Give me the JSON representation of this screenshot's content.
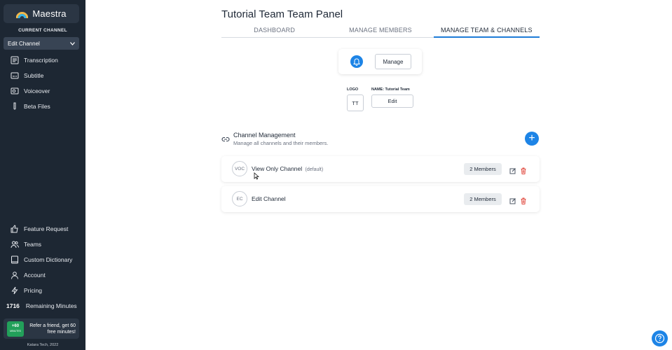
{
  "sidebar": {
    "brand_name": "Maestra",
    "current_channel_label": "CURRENT CHANNEL",
    "channel_select_value": "Edit Channel",
    "top_items": [
      {
        "label": "Transcription",
        "icon": "transcription-icon"
      },
      {
        "label": "Subtitle",
        "icon": "subtitle-icon"
      },
      {
        "label": "Voiceover",
        "icon": "voiceover-icon"
      },
      {
        "label": "Beta Files",
        "icon": "beta-icon"
      }
    ],
    "bottom_items": [
      {
        "label": "Feature Request",
        "icon": "thumbs-up-icon"
      },
      {
        "label": "Teams",
        "icon": "teams-icon"
      },
      {
        "label": "Custom Dictionary",
        "icon": "dictionary-icon"
      },
      {
        "label": "Account",
        "icon": "account-icon"
      },
      {
        "label": "Pricing",
        "icon": "lightning-icon"
      }
    ],
    "remaining_count": "1716",
    "remaining_label": "Remaining Minutes",
    "refer_badge_top": "+60",
    "refer_badge_bottom": "MINUTES",
    "refer_text": "Refer a friend, get 60 free minutes!",
    "footer": "Katara Tech, 2022"
  },
  "main": {
    "title": "Tutorial Team Team Panel",
    "tabs": [
      {
        "label": "DASHBOARD"
      },
      {
        "label": "MANAGE MEMBERS"
      },
      {
        "label": "MANAGE TEAM & CHANNELS"
      }
    ],
    "manage_label": "Manage",
    "logo_label": "LOGO",
    "logo_initials": "TT",
    "name_label": "NAME: Tutorial Team",
    "edit_label": "Edit",
    "channel_mgmt_title": "Channel Management",
    "channel_mgmt_sub": "Manage all channels and their members.",
    "add_symbol": "+",
    "channels": [
      {
        "initials": "VOC",
        "name": "View Only Channel",
        "tag": "(default)",
        "members": "2 Members"
      },
      {
        "initials": "EC",
        "name": "Edit Channel",
        "tag": "",
        "members": "2 Members"
      }
    ]
  },
  "colors": {
    "sidebar_bg": "#1d2733",
    "accent": "#1d84e6",
    "delete": "#e0453a"
  }
}
